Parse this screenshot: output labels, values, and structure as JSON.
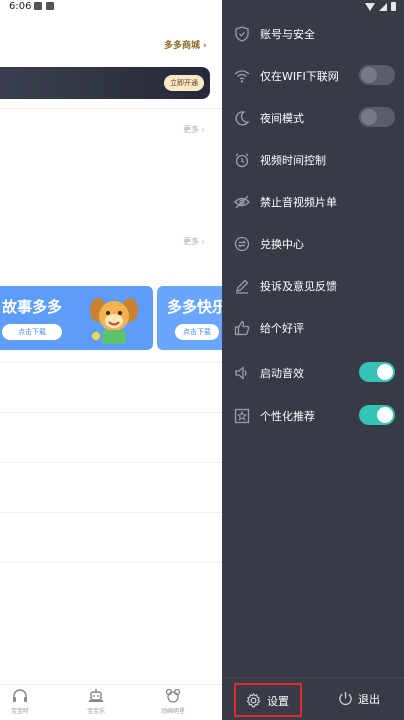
{
  "status_bar": {
    "time": "6:06"
  },
  "home": {
    "mall_link": "多多商城",
    "vip_button": "立即开通",
    "more_1": "更多",
    "more_2": "更多",
    "promos": [
      {
        "title": "故事多多",
        "button": "点击下载"
      },
      {
        "title": "多多快乐",
        "button": "点击下载"
      }
    ],
    "bottom_nav": [
      {
        "label": "宝宝听",
        "icon": "headphones-icon"
      },
      {
        "label": "宝宝乐",
        "icon": "robot-icon"
      },
      {
        "label": "动画明星",
        "icon": "bear-icon"
      }
    ]
  },
  "drawer": {
    "menu": [
      {
        "label": "账号与安全",
        "icon": "shield-icon",
        "toggle": null
      },
      {
        "label": "仅在WIFI下联网",
        "icon": "wifi-icon",
        "toggle": false
      },
      {
        "label": "夜间模式",
        "icon": "moon-icon",
        "toggle": false
      },
      {
        "label": "视频时间控制",
        "icon": "alarm-clock-icon",
        "toggle": null
      },
      {
        "label": "禁止音视频片单",
        "icon": "eye-off-icon",
        "toggle": null
      },
      {
        "label": "兑换中心",
        "icon": "exchange-icon",
        "toggle": null
      },
      {
        "label": "投诉及意见反馈",
        "icon": "pencil-icon",
        "toggle": null
      },
      {
        "label": "给个好评",
        "icon": "thumbs-up-icon",
        "toggle": null
      },
      {
        "label": "启动音效",
        "icon": "speaker-icon",
        "toggle": true
      },
      {
        "label": "个性化推荐",
        "icon": "star-box-icon",
        "toggle": true
      }
    ],
    "footer": {
      "settings_label": "设置",
      "logout_label": "退出"
    }
  },
  "colors": {
    "drawer_bg": "#373b46",
    "toggle_on": "#34c3b5",
    "highlight_border": "#e02b2b",
    "promo_blue": "#5d9df8"
  }
}
